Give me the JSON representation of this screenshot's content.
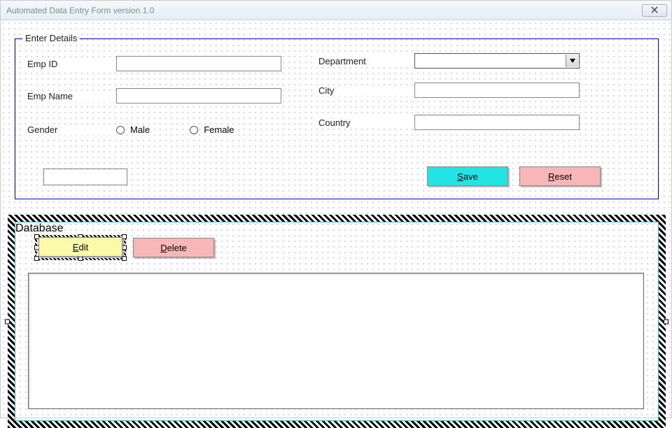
{
  "window": {
    "title": "Automated Data Entry Form version 1.0"
  },
  "enter": {
    "legend": "Enter Details",
    "labels": {
      "emp_id": "Emp ID",
      "emp_name": "Emp Name",
      "gender": "Gender",
      "department": "Department",
      "city": "City",
      "country": "Country"
    },
    "fields": {
      "emp_id": "",
      "emp_name": "",
      "department": "",
      "city": "",
      "country": "",
      "extra": ""
    },
    "gender_options": {
      "male": "Male",
      "female": "Female"
    },
    "buttons": {
      "save": "ave",
      "save_accel": "S",
      "reset": "eset",
      "reset_accel": "R"
    }
  },
  "db": {
    "legend": "Database",
    "buttons": {
      "edit": "dit",
      "edit_accel": "E",
      "delete": "elete",
      "delete_accel": "D"
    }
  }
}
